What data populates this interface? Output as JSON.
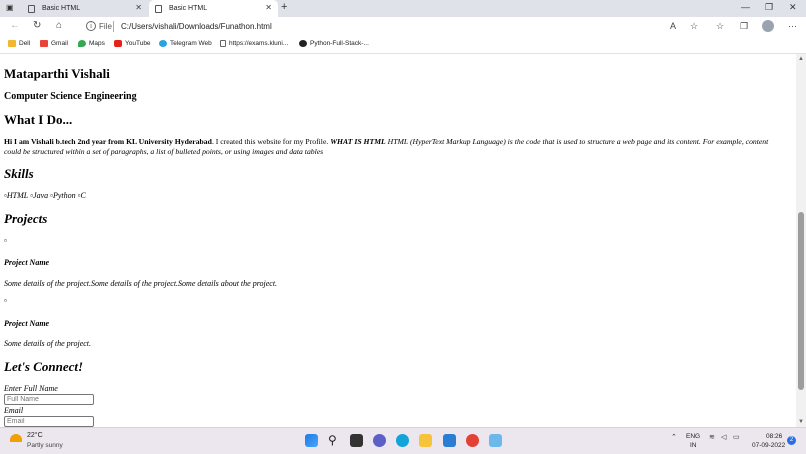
{
  "browser": {
    "tabs": [
      {
        "title": "Basic HTML"
      },
      {
        "title": "Basic HTML"
      }
    ],
    "address": {
      "scheme": "File",
      "url": "C:/Users/vishali/Downloads/Funathon.html"
    },
    "bookmarks": [
      "Dell",
      "Gmail",
      "Maps",
      "YouTube",
      "Telegram Web",
      "https://exams.kluni...",
      "Python-Full-Stack-..."
    ]
  },
  "page": {
    "name": "Mataparthi Vishali",
    "department": "Computer Science Engineering",
    "about_heading": "What I Do...",
    "about_bold": "Hi I am Vishali b.tech 2nd year from KL University Hyderabad",
    "about_plain": ". I created this website for my Profile.",
    "about_strong_em": "WHAT IS HTML",
    "about_em": "HTML (HyperText Markup Language) is the code that is used to structure a web page and its content. For example, content could be structured within a set of paragraphs, a list of bulleted points, or using images and data tables",
    "skills_heading": "Skills",
    "skills": [
      "HTML",
      "Java",
      "Python",
      "C"
    ],
    "projects_heading": "Projects",
    "projects": [
      {
        "name": "Project Name",
        "details": "Some details of the project.Some details of the project.Some details about the project."
      },
      {
        "name": "Project Name",
        "details": "Some details of the project."
      }
    ],
    "connect_heading": "Let's Connect!",
    "form": {
      "name_label": "Enter Full Name",
      "name_placeholder": "Full Name",
      "email_label": "Email",
      "email_placeholder": "Email"
    }
  },
  "taskbar": {
    "weather_temp": "22°C",
    "weather_desc": "Partly sunny",
    "lang_1": "ENG",
    "lang_2": "IN",
    "time": "08:26",
    "date": "07-09-2022",
    "notifications": "2"
  }
}
